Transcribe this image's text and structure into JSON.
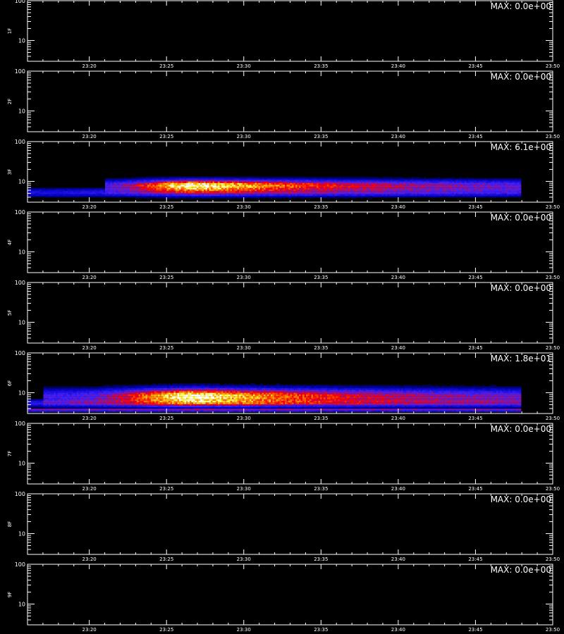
{
  "chart_data": {
    "type": "heatmap",
    "x_tick_labels": [
      "23:20",
      "23:25",
      "23:30",
      "23:35",
      "23:40",
      "23:45",
      "23:50"
    ],
    "x_range": [
      "23:16",
      "23:50"
    ],
    "y_scale": "log",
    "y_range": [
      3,
      100
    ],
    "y_tick_labels": [
      "100",
      "10"
    ],
    "data_end_time": "23:48",
    "colors": {
      "background": "#000000",
      "axes": "#ffffff",
      "colormap": [
        "#000000",
        "#0000c8",
        "#4020ff",
        "#ff0000",
        "#ff8c00",
        "#ffff40",
        "#ffffff"
      ]
    },
    "panels": [
      {
        "name": "1F",
        "max_text": "MAX: 0.0e+00",
        "max": 0.0,
        "bands": []
      },
      {
        "name": "2F",
        "max_text": "MAX: 0.0e+00",
        "max": 0.0,
        "bands": []
      },
      {
        "name": "3F",
        "max_text": "MAX: 6.1e+00",
        "max": 6.1,
        "bands": [
          {
            "y_center": 7.5,
            "y_half_width": 0.32,
            "x_start": "23:21",
            "x_end": "23:48",
            "peak_time": "23:27",
            "peak": 6.1,
            "rise_min": 2.5,
            "decay_min": 9,
            "floor": 1.6
          },
          {
            "y_center": 5.0,
            "y_half_width": 0.3,
            "x_start": "23:16",
            "x_end": "23:48",
            "peak_time": "23:28",
            "peak": 2.2,
            "rise_min": 4,
            "decay_min": 14,
            "floor": 1.2
          }
        ]
      },
      {
        "name": "4F",
        "max_text": "MAX: 0.0e+00",
        "max": 0.0,
        "bands": []
      },
      {
        "name": "5F",
        "max_text": "MAX: 0.0e+00",
        "max": 0.0,
        "bands": []
      },
      {
        "name": "6F",
        "max_text": "MAX: 1.8e+01",
        "max": 18.0,
        "bands": [
          {
            "y_center": 7.8,
            "y_half_width": 0.42,
            "x_start": "23:17",
            "x_end": "23:48",
            "peak_time": "23:27",
            "peak": 18.0,
            "rise_min": 3,
            "decay_min": 9,
            "floor": 5.0
          },
          {
            "y_center": 5.2,
            "y_half_width": 0.25,
            "x_start": "23:16",
            "x_end": "23:48",
            "peak_time": "23:28",
            "peak": 7.0,
            "rise_min": 5,
            "decay_min": 15,
            "floor": 4.0
          },
          {
            "y_center": 3.5,
            "y_half_width": 0.12,
            "x_start": "23:16",
            "x_end": "23:48",
            "peak_time": "23:30",
            "peak": 8.0,
            "rise_min": 20,
            "decay_min": 40,
            "floor": 7.0
          }
        ]
      },
      {
        "name": "7F",
        "max_text": "MAX: 0.0e+00",
        "max": 0.0,
        "bands": []
      },
      {
        "name": "8F",
        "max_text": "MAX: 0.0e+00",
        "max": 0.0,
        "bands": []
      },
      {
        "name": "9F",
        "max_text": "MAX: 0.0e+00",
        "max": 0.0,
        "bands": []
      }
    ]
  }
}
